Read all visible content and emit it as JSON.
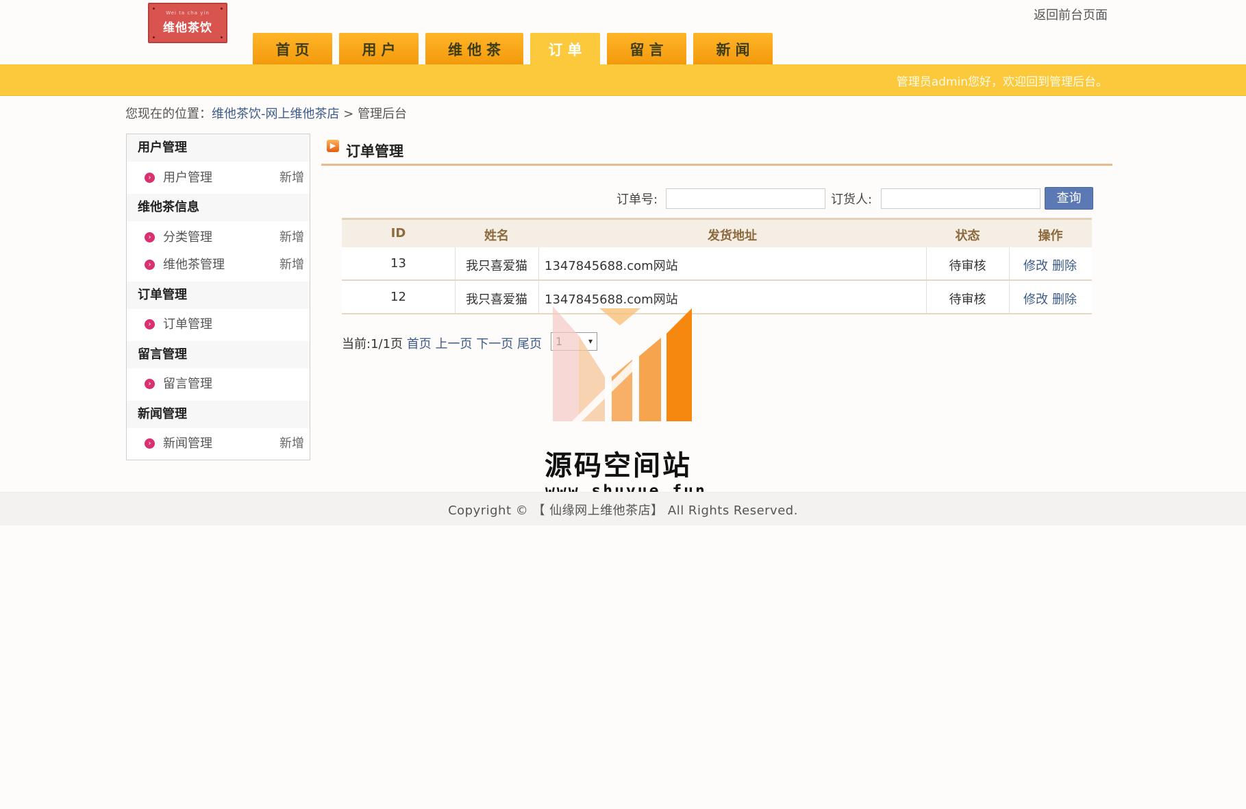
{
  "header": {
    "logo_small": "Wei ta cha yin",
    "logo_text": "维他茶饮",
    "back_link": "返回前台页面",
    "welcome": "管理员admin您好，欢迎回到管理后台。"
  },
  "nav": {
    "tabs": [
      {
        "label": "首页",
        "active": false
      },
      {
        "label": "用户",
        "active": false
      },
      {
        "label": "维他茶",
        "active": false
      },
      {
        "label": "订单",
        "active": true
      },
      {
        "label": "留言",
        "active": false
      },
      {
        "label": "新闻",
        "active": false
      }
    ]
  },
  "breadcrumb": {
    "prefix": "您现在的位置：",
    "link": "维他茶饮-网上维他茶店",
    "separator": ">",
    "current": "管理后台"
  },
  "sidebar": {
    "groups": [
      {
        "title": "用户管理",
        "items": [
          {
            "label": "用户管理",
            "add": "新增"
          }
        ]
      },
      {
        "title": "维他茶信息",
        "items": [
          {
            "label": "分类管理",
            "add": "新增"
          },
          {
            "label": "维他茶管理",
            "add": "新增"
          }
        ]
      },
      {
        "title": "订单管理",
        "items": [
          {
            "label": "订单管理",
            "add": ""
          }
        ]
      },
      {
        "title": "留言管理",
        "items": [
          {
            "label": "留言管理",
            "add": ""
          }
        ]
      },
      {
        "title": "新闻管理",
        "items": [
          {
            "label": "新闻管理",
            "add": "新增"
          }
        ]
      }
    ]
  },
  "main": {
    "title": "订单管理",
    "search": {
      "order_label": "订单号:",
      "order_value": "",
      "buyer_label": "订货人:",
      "buyer_value": "",
      "button": "查询"
    },
    "table": {
      "headers": [
        "ID",
        "姓名",
        "发货地址",
        "状态",
        "操作"
      ],
      "rows": [
        {
          "id": "13",
          "name": "我只喜爱猫",
          "address": "1347845688.com网站",
          "status": "待审核",
          "edit": "修改",
          "delete": "删除"
        },
        {
          "id": "12",
          "name": "我只喜爱猫",
          "address": "1347845688.com网站",
          "status": "待审核",
          "edit": "修改",
          "delete": "删除"
        }
      ]
    },
    "pager": {
      "current": "当前:1/1页",
      "first": "首页",
      "prev": "上一页",
      "next": "下一页",
      "last": "尾页",
      "select_value": "1"
    }
  },
  "watermark": {
    "title": "源码空间站",
    "url": "www.shuyue.fun"
  },
  "footer": {
    "copyright": "Copyright © 【 仙缘网上维他茶店】 All Rights Reserved."
  },
  "colors": {
    "nav_tab": "#f5a418",
    "nav_active": "#fcc93c",
    "bar": "#fcc93c",
    "link": "#3c5a8a",
    "query_button": "#5b7ab5",
    "bullet": "#d9306f"
  }
}
